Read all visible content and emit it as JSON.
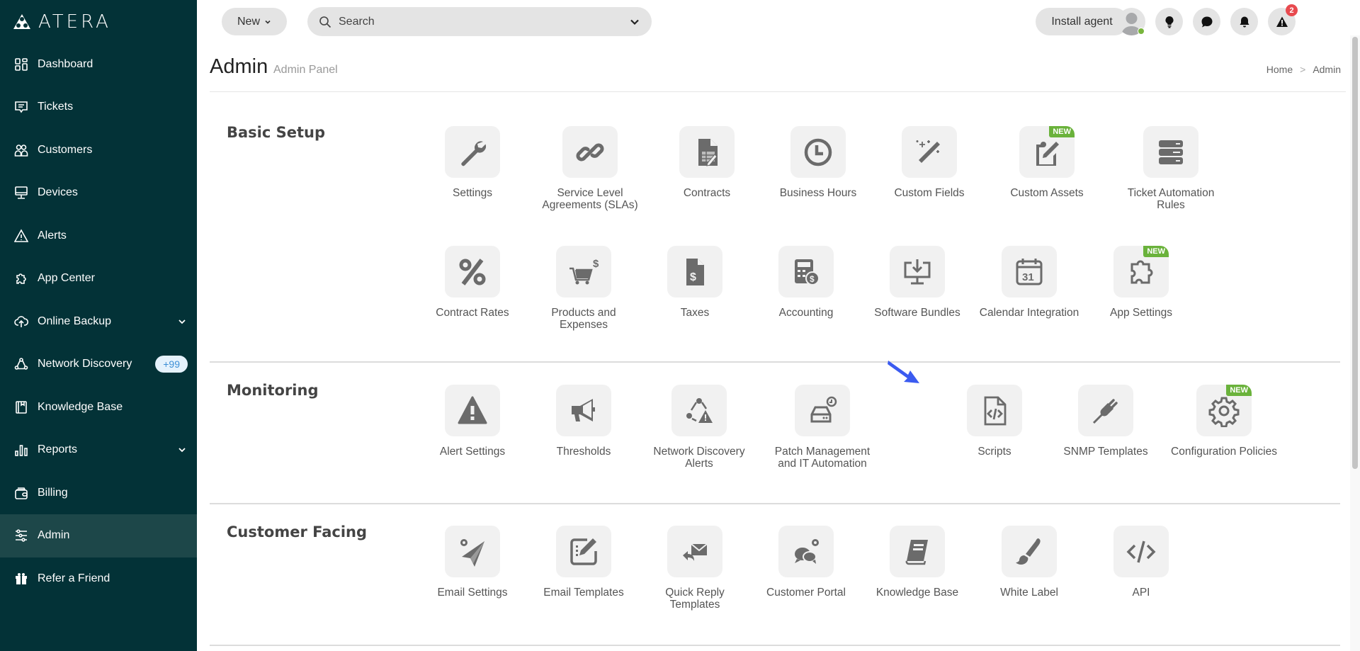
{
  "brand": {
    "name": "ATERA"
  },
  "sidebar": {
    "items": [
      {
        "label": "Dashboard",
        "icon": "dashboard-icon"
      },
      {
        "label": "Tickets",
        "icon": "tickets-icon"
      },
      {
        "label": "Customers",
        "icon": "customers-icon"
      },
      {
        "label": "Devices",
        "icon": "devices-icon"
      },
      {
        "label": "Alerts",
        "icon": "alerts-icon"
      },
      {
        "label": "App Center",
        "icon": "puzzle-icon"
      },
      {
        "label": "Online Backup",
        "icon": "cloud-upload-icon",
        "expandable": true
      },
      {
        "label": "Network Discovery",
        "icon": "network-icon",
        "badge": "+99"
      },
      {
        "label": "Knowledge Base",
        "icon": "book-icon"
      },
      {
        "label": "Reports",
        "icon": "bar-chart-icon",
        "expandable": true
      },
      {
        "label": "Billing",
        "icon": "wallet-icon"
      },
      {
        "label": "Admin",
        "icon": "sliders-icon",
        "active": true
      },
      {
        "label": "Refer a Friend",
        "icon": "gift-icon"
      }
    ]
  },
  "topbar": {
    "new_label": "New",
    "search_placeholder": "Search",
    "install_agent_label": "Install agent",
    "alerts_count": "2"
  },
  "header": {
    "title": "Admin",
    "subtitle": "Admin Panel",
    "breadcrumb": [
      "Home",
      ">",
      "Admin"
    ]
  },
  "sections": [
    {
      "title": "Basic Setup",
      "rows": [
        [
          {
            "label": "Settings",
            "icon": "wrench-icon"
          },
          {
            "label": "Service Level Agreements (SLAs)",
            "icon": "link-icon"
          },
          {
            "label": "Contracts",
            "icon": "contract-icon"
          },
          {
            "label": "Business Hours",
            "icon": "clock-icon"
          },
          {
            "label": "Custom Fields",
            "icon": "magic-wand-icon"
          },
          {
            "label": "Custom Assets",
            "icon": "clipboard-edit-icon",
            "badge": "NEW"
          },
          {
            "label": "Ticket Automation Rules",
            "icon": "server-stack-icon"
          }
        ],
        [
          {
            "label": "Contract Rates",
            "icon": "percent-icon"
          },
          {
            "label": "Products and Expenses",
            "icon": "cart-dollar-icon"
          },
          {
            "label": "Taxes",
            "icon": "file-dollar-icon"
          },
          {
            "label": "Accounting",
            "icon": "calculator-icon"
          },
          {
            "label": "Software Bundles",
            "icon": "monitor-download-icon"
          },
          {
            "label": "Calendar Integration",
            "icon": "calendar-icon",
            "calendar_day": "31"
          },
          {
            "label": "App Settings",
            "icon": "puzzle-icon",
            "badge": "NEW"
          }
        ]
      ]
    },
    {
      "title": "Monitoring",
      "rows": [
        [
          {
            "label": "Alert Settings",
            "icon": "warning-icon"
          },
          {
            "label": "Thresholds",
            "icon": "megaphone-icon"
          },
          {
            "label": "Network Discovery Alerts",
            "icon": "network-alert-icon"
          },
          {
            "label": "Patch Management and IT Automation",
            "icon": "drive-clock-icon"
          },
          {
            "label": "Scripts",
            "icon": "code-file-icon"
          },
          {
            "label": "SNMP Templates",
            "icon": "plug-icon"
          },
          {
            "label": "Configuration Policies",
            "icon": "gear-icon",
            "badge": "NEW"
          }
        ]
      ]
    },
    {
      "title": "Customer Facing",
      "rows": [
        [
          {
            "label": "Email Settings",
            "icon": "paper-plane-gear-icon"
          },
          {
            "label": "Email Templates",
            "icon": "edit-template-icon"
          },
          {
            "label": "Quick Reply Templates",
            "icon": "reply-mail-icon"
          },
          {
            "label": "Customer Portal",
            "icon": "chat-gear-icon"
          },
          {
            "label": "Knowledge Base",
            "icon": "book-icon"
          },
          {
            "label": "White Label",
            "icon": "paintbrush-icon"
          },
          {
            "label": "API",
            "icon": "code-icon"
          }
        ]
      ]
    }
  ],
  "colors": {
    "sidebar_bg": "#033237",
    "sidebar_active": "#1d4749",
    "new_badge": "#6ab23b",
    "alert_badge": "#e84a4f",
    "online_dot": "#78b53c",
    "pointer_arrow": "#3b5bf0"
  }
}
